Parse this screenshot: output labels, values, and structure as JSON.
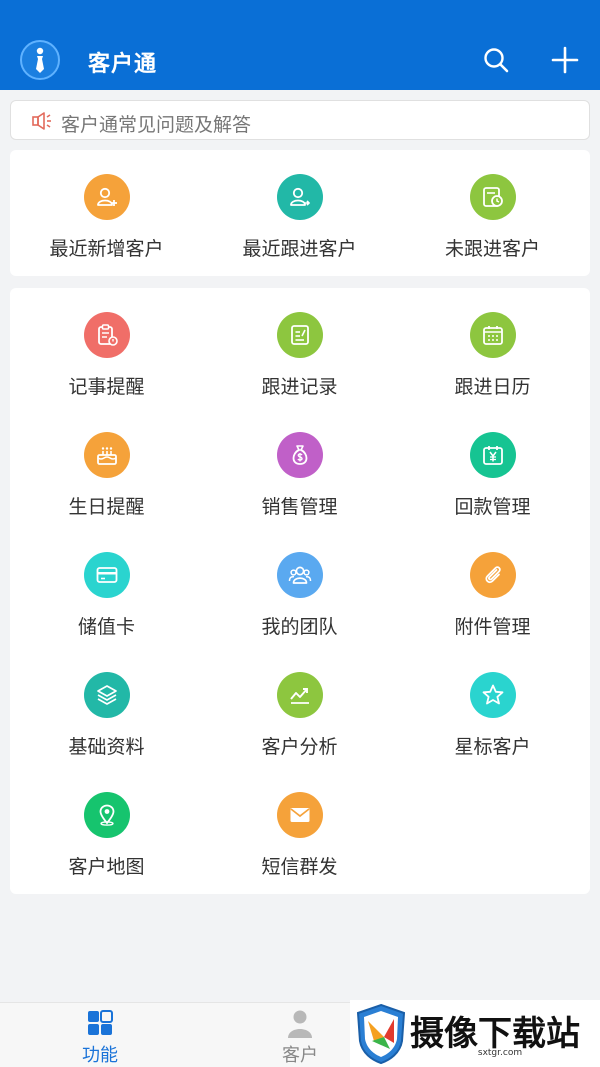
{
  "header": {
    "title": "客户通",
    "search_icon": "search-icon",
    "add_icon": "plus-icon"
  },
  "notice": {
    "text": "客户通常见问题及解答",
    "icon": "speaker-icon"
  },
  "quick": [
    {
      "label": "最近新增客户",
      "color": "#f5a23a",
      "icon": "user-add-icon"
    },
    {
      "label": "最近跟进客户",
      "color": "#22b8a7",
      "icon": "user-follow-icon"
    },
    {
      "label": "未跟进客户",
      "color": "#8dc63f",
      "icon": "clock-doc-icon"
    }
  ],
  "grid": [
    {
      "label": "记事提醒",
      "color": "#f06e68",
      "icon": "clipboard-alert-icon"
    },
    {
      "label": "跟进记录",
      "color": "#8dc63f",
      "icon": "note-edit-icon"
    },
    {
      "label": "跟进日历",
      "color": "#8dc63f",
      "icon": "calendar-icon"
    },
    {
      "label": "生日提醒",
      "color": "#f5a23a",
      "icon": "cake-icon"
    },
    {
      "label": "销售管理",
      "color": "#c060c8",
      "icon": "money-bag-icon"
    },
    {
      "label": "回款管理",
      "color": "#16c492",
      "icon": "yen-calendar-icon"
    },
    {
      "label": "储值卡",
      "color": "#2ad4cf",
      "icon": "card-icon"
    },
    {
      "label": "我的团队",
      "color": "#5aa9f0",
      "icon": "team-icon"
    },
    {
      "label": "附件管理",
      "color": "#f5a23a",
      "icon": "paperclip-icon"
    },
    {
      "label": "基础资料",
      "color": "#22b8a7",
      "icon": "layers-icon"
    },
    {
      "label": "客户分析",
      "color": "#8dc63f",
      "icon": "trend-chart-icon"
    },
    {
      "label": "星标客户",
      "color": "#2ad4cf",
      "icon": "star-icon"
    },
    {
      "label": "客户地图",
      "color": "#16c46e",
      "icon": "map-pin-icon"
    },
    {
      "label": "短信群发",
      "color": "#f5a23a",
      "icon": "mail-icon"
    }
  ],
  "tabs": [
    {
      "label": "功能",
      "icon": "grid-icon",
      "active": true
    },
    {
      "label": "客户",
      "icon": "person-icon",
      "active": false
    }
  ],
  "watermark": {
    "text": "摄像下载站",
    "sub": "sxtgr.com"
  }
}
